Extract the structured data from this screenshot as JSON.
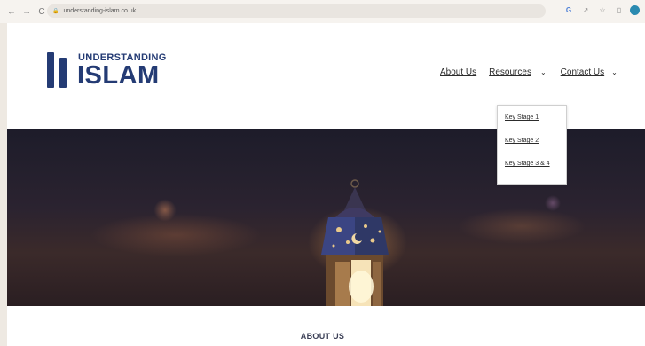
{
  "browser": {
    "url": "understanding-islam.co.uk",
    "back_icon": "←",
    "forward_icon": "→",
    "reload_icon": "C",
    "lock_icon": "🔒",
    "toolbar_icons": [
      "G",
      "↗",
      "☆",
      "▯"
    ]
  },
  "logo": {
    "line1": "UNDERSTANDING",
    "line2": "ISLAM"
  },
  "nav": {
    "about": "About Us",
    "resources": "Resources",
    "resources_caret": "⌄",
    "contact": "Contact Us",
    "contact_caret": "⌄"
  },
  "dropdown": {
    "items": [
      "Key Stage 1",
      "Key Stage 2",
      "Key Stage 3 & 4"
    ]
  },
  "section": {
    "title": "ABOUT US"
  },
  "colors": {
    "brand": "#243b74",
    "page_background": "#ffffff",
    "frame_background": "#eee9e2"
  }
}
